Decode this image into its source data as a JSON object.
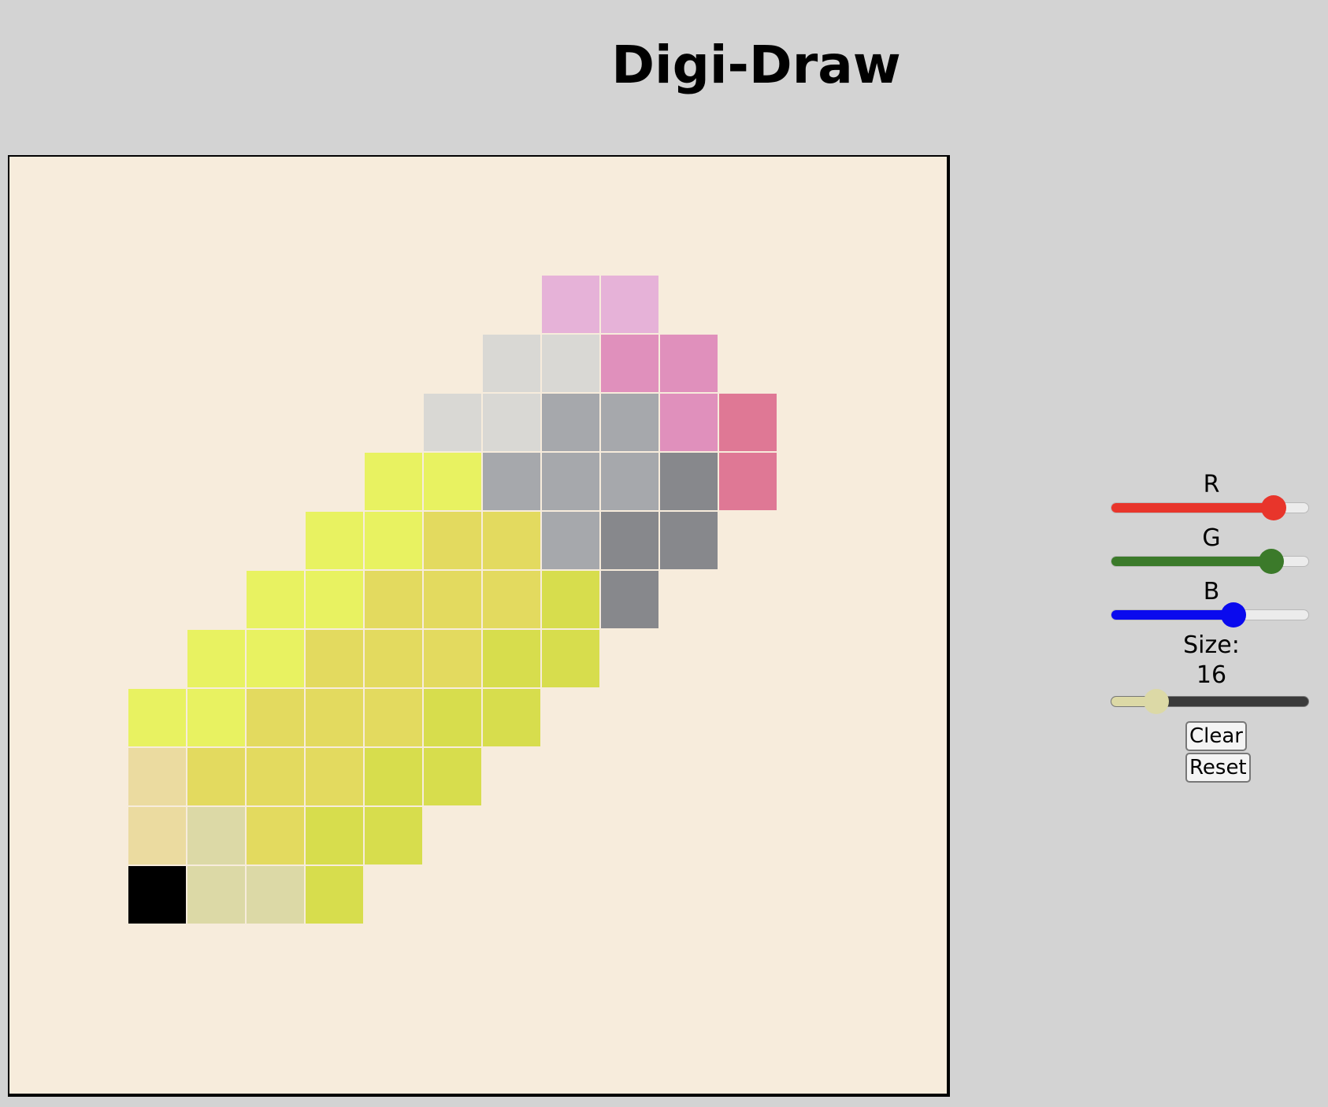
{
  "app": {
    "title": "Digi-Draw"
  },
  "canvas": {
    "background": "#f7ecdc",
    "grid_lines": "#ffffff",
    "grid_cells": 16,
    "painted": [
      {
        "row": 2,
        "col": 9,
        "color": "#e6b2d8"
      },
      {
        "row": 2,
        "col": 10,
        "color": "#e6b2d8"
      },
      {
        "row": 3,
        "col": 8,
        "color": "#d9d8d4"
      },
      {
        "row": 3,
        "col": 9,
        "color": "#d9d8d4"
      },
      {
        "row": 3,
        "col": 10,
        "color": "#e090bc"
      },
      {
        "row": 3,
        "col": 11,
        "color": "#e090bc"
      },
      {
        "row": 4,
        "col": 7,
        "color": "#d9d8d4"
      },
      {
        "row": 4,
        "col": 8,
        "color": "#d9d8d4"
      },
      {
        "row": 4,
        "col": 9,
        "color": "#a6a8ac"
      },
      {
        "row": 4,
        "col": 10,
        "color": "#a6a8ac"
      },
      {
        "row": 4,
        "col": 11,
        "color": "#e090bc"
      },
      {
        "row": 4,
        "col": 12,
        "color": "#df7895"
      },
      {
        "row": 5,
        "col": 6,
        "color": "#e8f261"
      },
      {
        "row": 5,
        "col": 7,
        "color": "#e8f261"
      },
      {
        "row": 5,
        "col": 8,
        "color": "#a6a8ac"
      },
      {
        "row": 5,
        "col": 9,
        "color": "#a6a8ac"
      },
      {
        "row": 5,
        "col": 10,
        "color": "#a6a8ac"
      },
      {
        "row": 5,
        "col": 11,
        "color": "#87888c"
      },
      {
        "row": 5,
        "col": 12,
        "color": "#df7895"
      },
      {
        "row": 6,
        "col": 5,
        "color": "#e8f261"
      },
      {
        "row": 6,
        "col": 6,
        "color": "#e8f261"
      },
      {
        "row": 6,
        "col": 7,
        "color": "#e3da5f"
      },
      {
        "row": 6,
        "col": 8,
        "color": "#e3da5f"
      },
      {
        "row": 6,
        "col": 9,
        "color": "#a6a8ac"
      },
      {
        "row": 6,
        "col": 10,
        "color": "#87888c"
      },
      {
        "row": 6,
        "col": 11,
        "color": "#87888c"
      },
      {
        "row": 7,
        "col": 4,
        "color": "#e8f261"
      },
      {
        "row": 7,
        "col": 5,
        "color": "#e8f261"
      },
      {
        "row": 7,
        "col": 6,
        "color": "#e3da5f"
      },
      {
        "row": 7,
        "col": 7,
        "color": "#e3da5f"
      },
      {
        "row": 7,
        "col": 8,
        "color": "#e3da5f"
      },
      {
        "row": 7,
        "col": 9,
        "color": "#d7dd4d"
      },
      {
        "row": 7,
        "col": 10,
        "color": "#87888c"
      },
      {
        "row": 8,
        "col": 3,
        "color": "#e8f261"
      },
      {
        "row": 8,
        "col": 4,
        "color": "#e8f261"
      },
      {
        "row": 8,
        "col": 5,
        "color": "#e3da5f"
      },
      {
        "row": 8,
        "col": 6,
        "color": "#e3da5f"
      },
      {
        "row": 8,
        "col": 7,
        "color": "#e3da5f"
      },
      {
        "row": 8,
        "col": 8,
        "color": "#d7dd4d"
      },
      {
        "row": 8,
        "col": 9,
        "color": "#d7dd4d"
      },
      {
        "row": 9,
        "col": 2,
        "color": "#e8f261"
      },
      {
        "row": 9,
        "col": 3,
        "color": "#e8f261"
      },
      {
        "row": 9,
        "col": 4,
        "color": "#e3da5f"
      },
      {
        "row": 9,
        "col": 5,
        "color": "#e3da5f"
      },
      {
        "row": 9,
        "col": 6,
        "color": "#e3da5f"
      },
      {
        "row": 9,
        "col": 7,
        "color": "#d7dd4d"
      },
      {
        "row": 9,
        "col": 8,
        "color": "#d7dd4d"
      },
      {
        "row": 10,
        "col": 2,
        "color": "#ebdba0"
      },
      {
        "row": 10,
        "col": 3,
        "color": "#e3da5f"
      },
      {
        "row": 10,
        "col": 4,
        "color": "#e3da5f"
      },
      {
        "row": 10,
        "col": 5,
        "color": "#e3da5f"
      },
      {
        "row": 10,
        "col": 6,
        "color": "#d7dd4d"
      },
      {
        "row": 10,
        "col": 7,
        "color": "#d7dd4d"
      },
      {
        "row": 11,
        "col": 2,
        "color": "#ebdba0"
      },
      {
        "row": 11,
        "col": 3,
        "color": "#dcd9a6"
      },
      {
        "row": 11,
        "col": 4,
        "color": "#e3da5f"
      },
      {
        "row": 11,
        "col": 5,
        "color": "#d7dd4d"
      },
      {
        "row": 11,
        "col": 6,
        "color": "#d7dd4d"
      },
      {
        "row": 12,
        "col": 2,
        "color": "#000000"
      },
      {
        "row": 12,
        "col": 3,
        "color": "#dcd9a6"
      },
      {
        "row": 12,
        "col": 4,
        "color": "#dcd9a6"
      },
      {
        "row": 12,
        "col": 5,
        "color": "#d7dd4d"
      }
    ]
  },
  "controls": {
    "r_label": "R",
    "g_label": "G",
    "b_label": "B",
    "r_level": 0.82,
    "g_level": 0.81,
    "b_level": 0.62,
    "r_color": "#e8352b",
    "g_color": "#3b7a2a",
    "b_color": "#0a0aee",
    "size_label": "Size:",
    "size_value": "16",
    "size_level": 0.23,
    "size_thumb_color": "#dcd9a6",
    "clear_label": "Clear",
    "reset_label": "Reset"
  }
}
